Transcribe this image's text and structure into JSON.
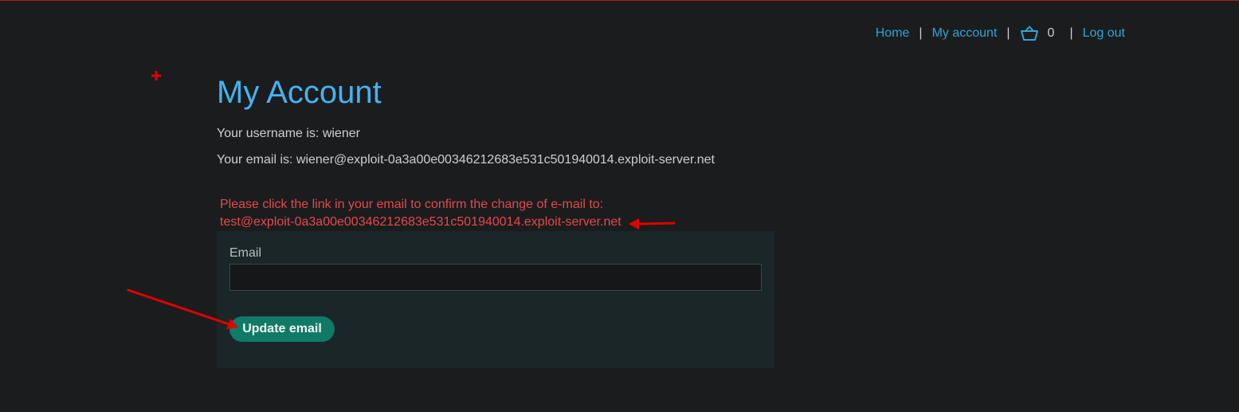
{
  "nav": {
    "home": "Home",
    "my_account": "My account",
    "cart_count": "0",
    "log_out": "Log out",
    "separator": "|"
  },
  "icons": {
    "cart": "basket-icon",
    "crosshair": "crosshair-icon"
  },
  "main": {
    "title": "My Account",
    "username_line": "Your username is: wiener",
    "email_line": "Your email is: wiener@exploit-0a3a00e00346212683e531c501940014.exploit-server.net",
    "notice_line1": "Please click the link in your email to confirm the change of e-mail to:",
    "notice_line2": "test@exploit-0a3a00e00346212683e531c501940014.exploit-server.net"
  },
  "form": {
    "email_label": "Email",
    "email_value": "",
    "submit_label": "Update email"
  },
  "colors": {
    "background": "#1b1c1e",
    "link": "#2fa5d6",
    "title": "#47b1f0",
    "notice": "#e44a4a",
    "button": "#0f7a66",
    "annotation": "#e00000"
  }
}
